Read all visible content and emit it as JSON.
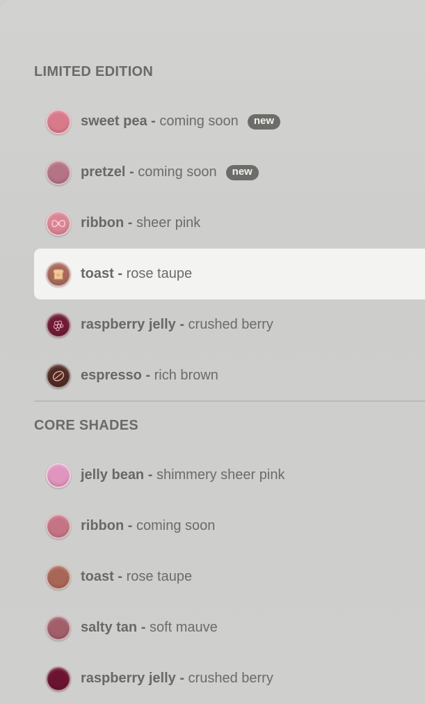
{
  "limited_edition": {
    "title": "LIMITED EDITION",
    "items": [
      {
        "name": "sweet pea",
        "separator": "-",
        "desc": "coming soon",
        "badge": "new",
        "color": "#d97a8a",
        "icon": "plain-swatch-icon"
      },
      {
        "name": "pretzel",
        "separator": "-",
        "desc": "coming soon",
        "badge": "new",
        "color": "#b47486",
        "icon": "plain-swatch-icon"
      },
      {
        "name": "ribbon",
        "separator": "-",
        "desc": "sheer pink",
        "badge": "",
        "color": "#d98596",
        "icon": "bow-swatch-icon"
      },
      {
        "name": "toast",
        "separator": "-",
        "desc": "rose taupe",
        "badge": "",
        "color": "#a8685a",
        "icon": "toast-swatch-icon"
      },
      {
        "name": "raspberry jelly",
        "separator": "-",
        "desc": "crushed berry",
        "badge": "",
        "color": "#6e1c36",
        "icon": "raspberry-swatch-icon"
      },
      {
        "name": "espresso",
        "separator": "-",
        "desc": "rich brown",
        "badge": "",
        "color": "#4f2b24",
        "icon": "coffee-bean-swatch-icon"
      }
    ]
  },
  "core_shades": {
    "title": "CORE SHADES",
    "items": [
      {
        "name": "jelly bean",
        "separator": "-",
        "desc": "shimmery sheer pink",
        "badge": "",
        "color": "#df95bd",
        "icon": "plain-swatch-icon"
      },
      {
        "name": "ribbon",
        "separator": "-",
        "desc": "coming soon",
        "badge": "",
        "color": "#c57485",
        "icon": "plain-swatch-icon"
      },
      {
        "name": "toast",
        "separator": "-",
        "desc": "rose taupe",
        "badge": "",
        "color": "#a86656",
        "icon": "plain-swatch-icon"
      },
      {
        "name": "salty tan",
        "separator": "-",
        "desc": "soft mauve",
        "badge": "",
        "color": "#a15f6a",
        "icon": "plain-swatch-icon"
      },
      {
        "name": "raspberry jelly",
        "separator": "-",
        "desc": "crushed berry",
        "badge": "",
        "color": "#6b1432",
        "icon": "plain-swatch-icon"
      }
    ]
  },
  "selected_shade": "toast - rose taupe (limited edition)"
}
